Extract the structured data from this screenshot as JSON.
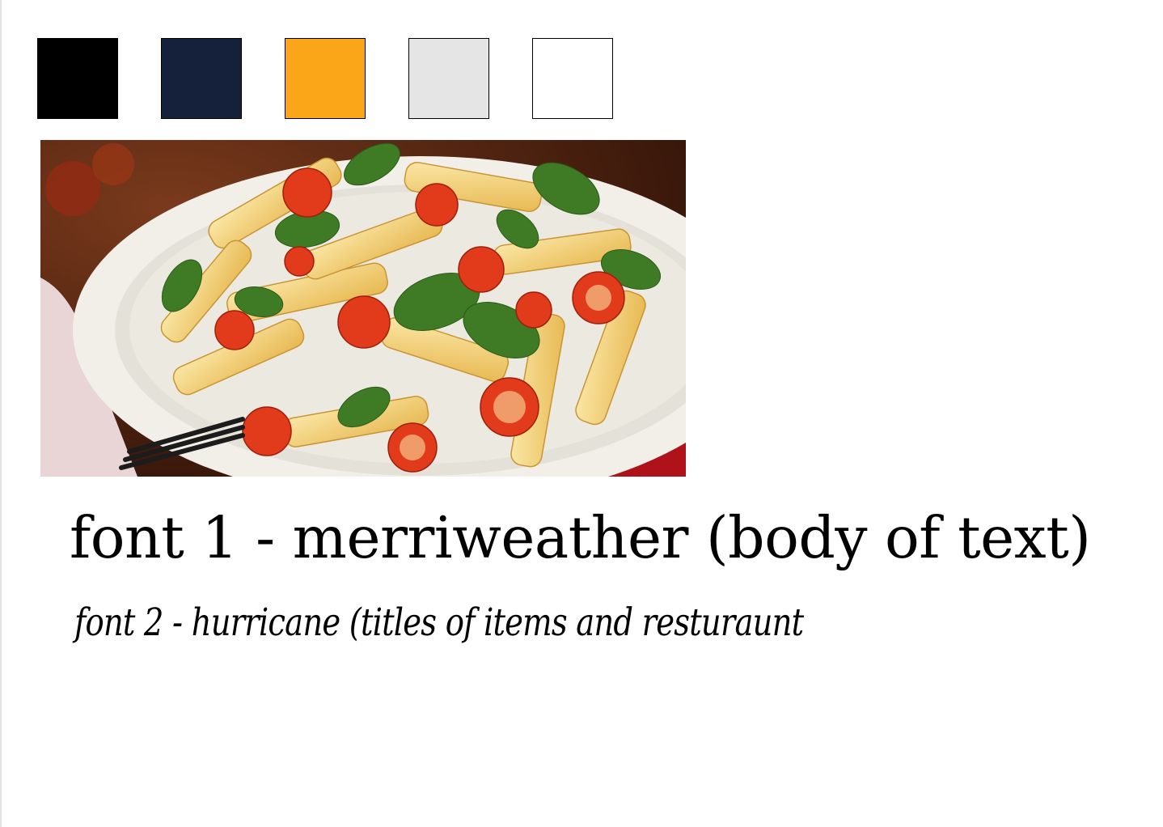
{
  "palette": {
    "swatches": [
      {
        "name": "black",
        "color": "#000000"
      },
      {
        "name": "navy",
        "color": "#15203B"
      },
      {
        "name": "orange",
        "color": "#FBA619"
      },
      {
        "name": "light-gray",
        "color": "#E5E5E5"
      },
      {
        "name": "white",
        "color": "#FFFFFF"
      }
    ]
  },
  "photo": {
    "subject": "penne-pasta-with-tomatoes-and-basil"
  },
  "fonts": {
    "font1": "font 1 - merriweather (body of text)",
    "font2": "font 2 - hurricane (titles of items and resturaunt"
  }
}
